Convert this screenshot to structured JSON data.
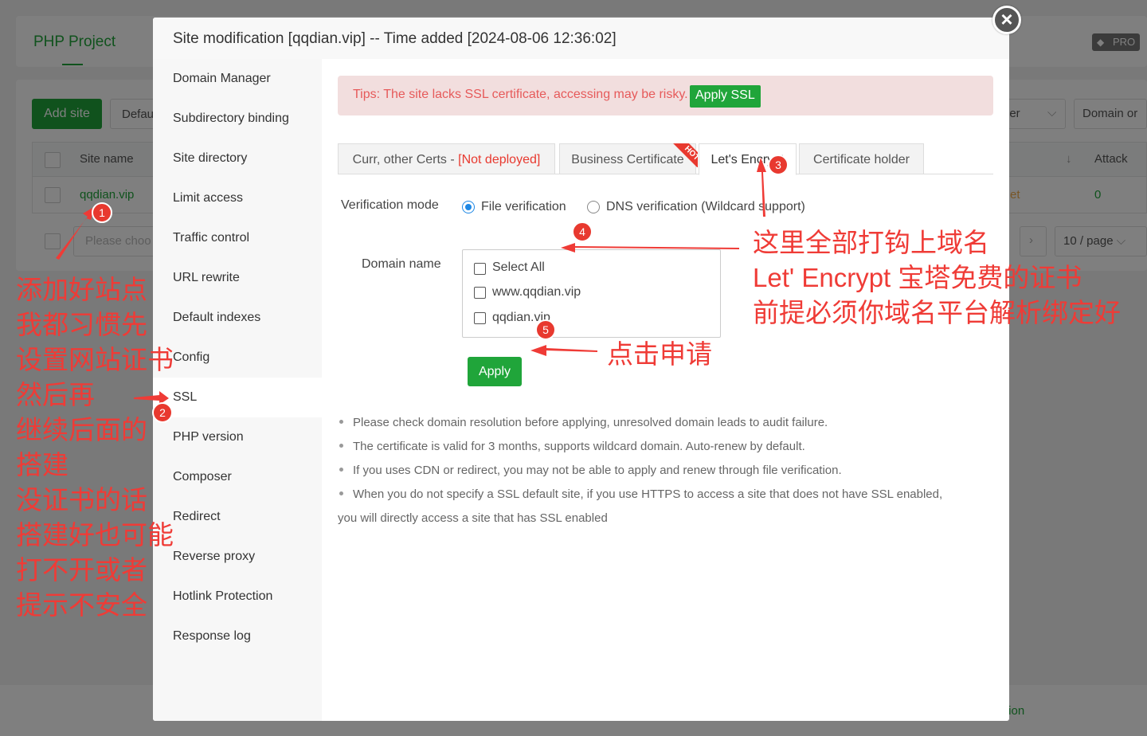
{
  "background": {
    "tab_php_project": "PHP Project",
    "pro_badge": "PRO",
    "add_site": "Add site",
    "default_select": "Defau",
    "col_site_name": "Site name",
    "col_attack": "Attack",
    "site_link": "qqdian.vip",
    "search_placeholder": "Please choo",
    "select_manager": "ger",
    "select_domain": "Domain or",
    "row_status": "et",
    "row_attack": "0",
    "page_size": "10 / page",
    "footer_text": "tion"
  },
  "modal": {
    "title": "Site modification [qqdian.vip] -- Time added [2024-08-06 12:36:02]",
    "close_glyph": "×",
    "sidebar": [
      "Domain Manager",
      "Subdirectory binding",
      "Site directory",
      "Limit access",
      "Traffic control",
      "URL rewrite",
      "Default indexes",
      "Config",
      "SSL",
      "PHP version",
      "Composer",
      "Redirect",
      "Reverse proxy",
      "Hotlink Protection",
      "Response log"
    ],
    "active_sidebar": "SSL",
    "tips_text": "Tips: The site lacks SSL certificate, accessing may be risky.",
    "apply_ssl": "Apply SSL",
    "tabs": {
      "curr_certs": "Curr, other Certs - ",
      "not_deployed": "[Not deployed]",
      "business": "Business Certificate",
      "hot": "HOT",
      "lets_encrypt": "Let's Encrypt",
      "holder": "Certificate holder"
    },
    "verification_label": "Verification mode",
    "file_verification": "File verification",
    "dns_verification": "DNS verification (Wildcard support)",
    "domain_label": "Domain name",
    "domains": [
      "Select All",
      "www.qqdian.vip",
      "qqdian.vip"
    ],
    "apply": "Apply",
    "notes": [
      "Please check domain resolution before applying, unresolved domain leads to audit failure.",
      "The certificate is valid for 3 months, supports wildcard domain. Auto-renew by default.",
      "If you uses CDN or redirect, you may not be able to apply and renew through file verification.",
      "When you do not specify a SSL default site, if you use HTTPS to access a site that does not have SSL enabled,"
    ],
    "note_continuation": "you will directly access a site that has SSL enabled"
  },
  "annotations": {
    "badges": [
      "1",
      "2",
      "3",
      "4",
      "5"
    ],
    "left_lines": [
      "添加好站点",
      "我都习惯先",
      "设置网站证书",
      "然后再",
      "继续后面的",
      "搭建",
      "没证书的话",
      "搭建好也可能",
      "打不开或者",
      "提示不安全"
    ],
    "right_lines": [
      "这里全部打钩上域名",
      "Let' Encrypt 宝塔免费的证书",
      "前提必须你域名平台解析绑定好"
    ],
    "apply_note": "点击申请",
    "color": "#ef3b36"
  }
}
